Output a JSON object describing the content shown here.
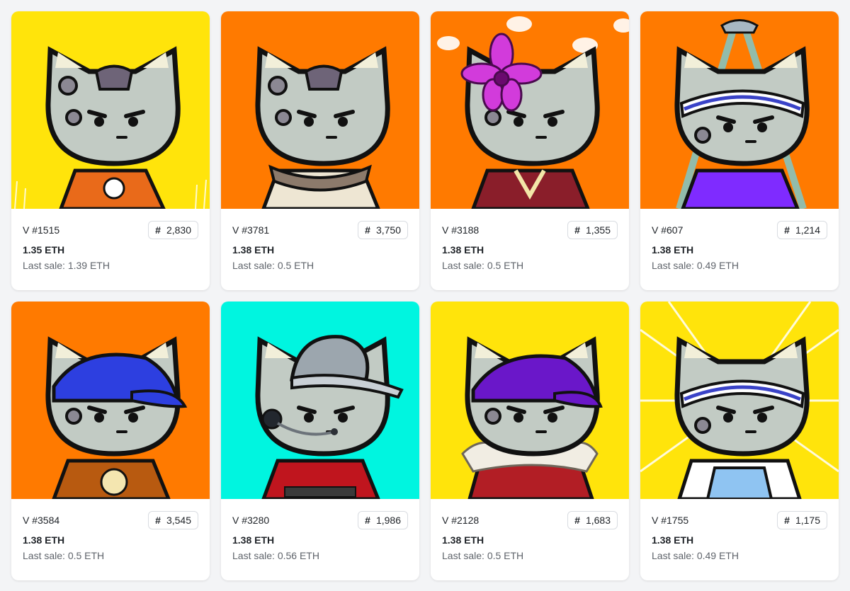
{
  "cards": [
    {
      "name": "V #1515",
      "rank_icon": "#",
      "rank": "2,830",
      "price": "1.35 ETH",
      "last_sale": "Last sale: 1.39 ETH",
      "background": "#FFE40B",
      "accent": "#E96A1A",
      "trait": "orange-skull-shirt"
    },
    {
      "name": "V #3781",
      "rank_icon": "#",
      "rank": "3,750",
      "price": "1.38 ETH",
      "last_sale": "Last sale: 0.5 ETH",
      "background": "#FF7A00",
      "accent": "#8C7A6B",
      "trait": "scarf"
    },
    {
      "name": "V #3188",
      "rank_icon": "#",
      "rank": "1,355",
      "price": "1.38 ETH",
      "last_sale": "Last sale: 0.5 ETH",
      "background": "#FF7A00",
      "accent": "#8A1E2A",
      "trait": "orchid-kimono"
    },
    {
      "name": "V #607",
      "rank_icon": "#",
      "rank": "1,214",
      "price": "1.38 ETH",
      "last_sale": "Last sale: 0.49 ETH",
      "background": "#FF7A00",
      "accent": "#7F2BFF",
      "trait": "shower-headband"
    },
    {
      "name": "V #3584",
      "rank_icon": "#",
      "rank": "3,545",
      "price": "1.38 ETH",
      "last_sale": "Last sale: 0.5 ETH",
      "background": "#FF7A00",
      "accent": "#B85A10",
      "trait": "blue-cap"
    },
    {
      "name": "V #3280",
      "rank_icon": "#",
      "rank": "1,986",
      "price": "1.38 ETH",
      "last_sale": "Last sale: 0.56 ETH",
      "background": "#00F5E0",
      "accent": "#C0151E",
      "trait": "bucket-hat-headset"
    },
    {
      "name": "V #2128",
      "rank_icon": "#",
      "rank": "1,683",
      "price": "1.38 ETH",
      "last_sale": "Last sale: 0.5 ETH",
      "background": "#FFE40B",
      "accent": "#B21E25",
      "trait": "purple-cap-parka"
    },
    {
      "name": "V #1755",
      "rank_icon": "#",
      "rank": "1,175",
      "price": "1.38 ETH",
      "last_sale": "Last sale: 0.49 ETH",
      "background": "#FFE40B",
      "accent": "#8FC4F2",
      "trait": "headband-overalls"
    }
  ]
}
